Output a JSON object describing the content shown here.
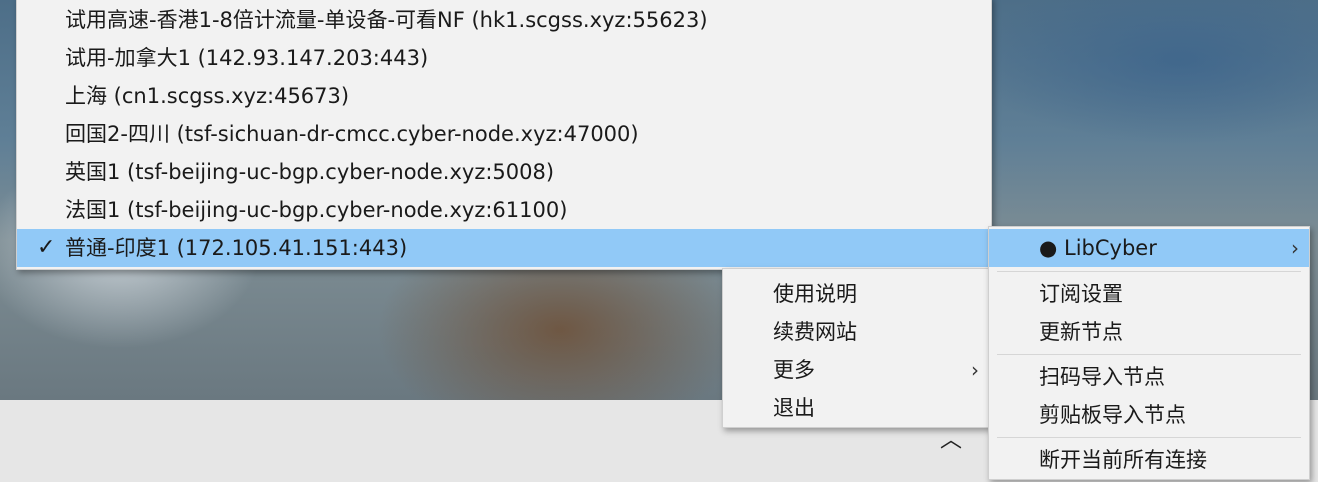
{
  "servers_menu": {
    "items": [
      {
        "label": "试用高速-香港1-8倍计流量-单设备-可看NF (hk1.scgss.xyz:55623)",
        "checked": false
      },
      {
        "label": "试用-加拿大1 (142.93.147.203:443)",
        "checked": false
      },
      {
        "label": "上海 (cn1.scgss.xyz:45673)",
        "checked": false
      },
      {
        "label": "回国2-四川 (tsf-sichuan-dr-cmcc.cyber-node.xyz:47000)",
        "checked": false
      },
      {
        "label": "英国1 (tsf-beijing-uc-bgp.cyber-node.xyz:5008)",
        "checked": false
      },
      {
        "label": "法国1 (tsf-beijing-uc-bgp.cyber-node.xyz:61100)",
        "checked": false
      },
      {
        "label": "普通-印度1 (172.105.41.151:443)",
        "checked": true
      }
    ],
    "check_glyph": "✓"
  },
  "main_menu": {
    "items": [
      {
        "label": "使用说明"
      },
      {
        "label": "续费网站"
      },
      {
        "label": "更多",
        "has_submenu": true
      },
      {
        "label": "退出"
      }
    ]
  },
  "sub_menu": {
    "header": "● LibCyber",
    "groups": [
      [
        "订阅设置",
        "更新节点"
      ],
      [
        "扫码导入节点",
        "剪贴板导入节点"
      ],
      [
        "断开当前所有连接"
      ]
    ]
  },
  "icons": {
    "submenu_arrow": "chevron-right-icon",
    "tray_overflow": "chevron-up-icon",
    "check": "checkmark-icon"
  },
  "colors": {
    "menu_bg": "#f2f2f2",
    "highlight": "#91c9f7",
    "taskbar": "#e6e6e6"
  }
}
